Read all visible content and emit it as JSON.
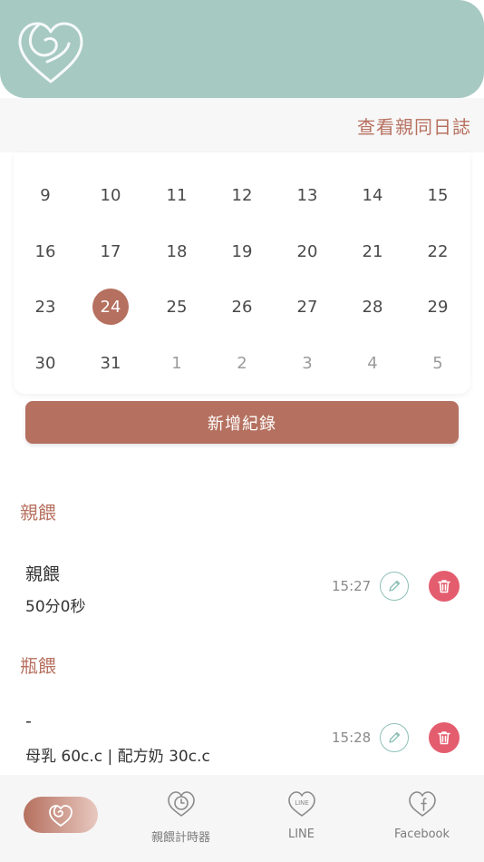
{
  "header": {
    "link_label": "查看親同日誌"
  },
  "calendar": {
    "rows": [
      [
        {
          "d": "9"
        },
        {
          "d": "10"
        },
        {
          "d": "11"
        },
        {
          "d": "12"
        },
        {
          "d": "13"
        },
        {
          "d": "14"
        },
        {
          "d": "15"
        }
      ],
      [
        {
          "d": "16"
        },
        {
          "d": "17"
        },
        {
          "d": "18"
        },
        {
          "d": "19"
        },
        {
          "d": "20"
        },
        {
          "d": "21"
        },
        {
          "d": "22"
        }
      ],
      [
        {
          "d": "23"
        },
        {
          "d": "24",
          "selected": true
        },
        {
          "d": "25"
        },
        {
          "d": "26"
        },
        {
          "d": "27"
        },
        {
          "d": "28"
        },
        {
          "d": "29"
        }
      ],
      [
        {
          "d": "30"
        },
        {
          "d": "31"
        },
        {
          "d": "1",
          "muted": true
        },
        {
          "d": "2",
          "muted": true
        },
        {
          "d": "3",
          "muted": true
        },
        {
          "d": "4",
          "muted": true
        },
        {
          "d": "5",
          "muted": true
        }
      ]
    ]
  },
  "add_button": {
    "label": "新增紀錄"
  },
  "sections": [
    {
      "title": "親餵",
      "record": {
        "title": "親餵",
        "detail": "50分0秒",
        "time": "15:27"
      }
    },
    {
      "title": "瓶餵",
      "record": {
        "title": "-",
        "detail": "母乳 60c.c | 配方奶 30c.c",
        "time": "15:28"
      }
    }
  ],
  "nav": {
    "items": [
      {
        "label": "",
        "icon": "heart-logo-icon",
        "active": true
      },
      {
        "label": "親餵計時器",
        "icon": "heart-clock-icon"
      },
      {
        "label": "LINE",
        "icon": "line-heart-icon"
      },
      {
        "label": "Facebook",
        "icon": "facebook-heart-icon"
      }
    ]
  },
  "colors": {
    "header_bg": "#a6c9c2",
    "accent": "#b5705f",
    "delete": "#e45d6e",
    "edit_border": "#8fc0b7"
  }
}
